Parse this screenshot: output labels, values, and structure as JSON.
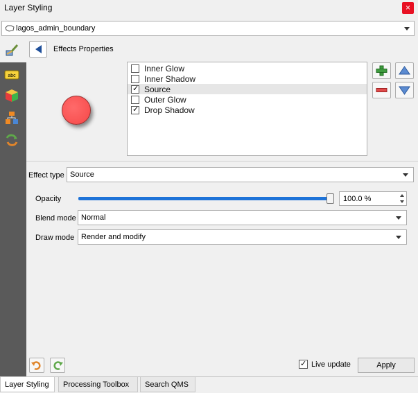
{
  "window": {
    "title": "Layer Styling",
    "close_label": "×"
  },
  "layer_selector": {
    "value": "lagos_admin_boundary"
  },
  "effects": {
    "title": "Effects Properties",
    "items": [
      {
        "label": "Inner Glow",
        "checked": false,
        "selected": false
      },
      {
        "label": "Inner Shadow",
        "checked": false,
        "selected": false
      },
      {
        "label": "Source",
        "checked": true,
        "selected": true
      },
      {
        "label": "Outer Glow",
        "checked": false,
        "selected": false
      },
      {
        "label": "Drop Shadow",
        "checked": true,
        "selected": false
      }
    ],
    "preview_color": "#f64848"
  },
  "effect_type": {
    "label": "Effect type",
    "value": "Source"
  },
  "opacity": {
    "label": "Opacity",
    "value": "100.0 %",
    "fraction": 1.0
  },
  "blend_mode": {
    "label": "Blend mode",
    "value": "Normal"
  },
  "draw_mode": {
    "label": "Draw mode",
    "value": "Render and modify"
  },
  "footer": {
    "live_update_label": "Live update",
    "live_update_checked": true,
    "apply_label": "Apply"
  },
  "tabs": [
    {
      "label": "Layer Styling",
      "active": true
    },
    {
      "label": "Processing Toolbox",
      "active": false
    },
    {
      "label": "Search QMS",
      "active": false
    }
  ],
  "icons": {
    "layer": "polygon-layer-icon",
    "strip": [
      "paintbrush-icon",
      "label-abc-icon",
      "3d-cube-icon",
      "diagram-icon",
      "history-icon"
    ],
    "add": "plus-icon",
    "remove": "minus-icon",
    "up": "arrow-up-icon",
    "down": "arrow-down-icon",
    "undo": "undo-icon",
    "redo": "redo-icon"
  },
  "colors": {
    "accent": "#1e73d8",
    "sidebar": "#5a5a5a",
    "close": "#e81123"
  }
}
